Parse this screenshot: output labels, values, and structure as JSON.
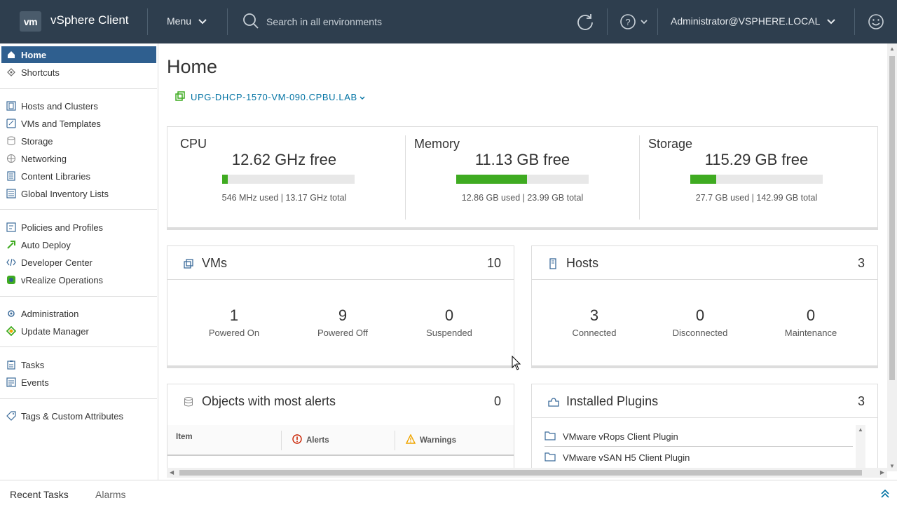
{
  "header": {
    "logo": "vm",
    "app_title": "vSphere Client",
    "menu_label": "Menu",
    "search_placeholder": "Search in all environments",
    "user": "Administrator@VSPHERE.LOCAL",
    "colors": {
      "bg": "#2e3e4e",
      "accent": "#0072a3",
      "bar_fill": "#3fab21"
    }
  },
  "sidebar": {
    "items": [
      {
        "label": "Home",
        "icon": "home-icon"
      },
      {
        "label": "Shortcuts",
        "icon": "shortcuts-icon"
      },
      {
        "label": "Hosts and Clusters",
        "icon": "hosts-clusters-icon"
      },
      {
        "label": "VMs and Templates",
        "icon": "vms-templates-icon"
      },
      {
        "label": "Storage",
        "icon": "storage-icon"
      },
      {
        "label": "Networking",
        "icon": "networking-icon"
      },
      {
        "label": "Content Libraries",
        "icon": "content-libraries-icon"
      },
      {
        "label": "Global Inventory Lists",
        "icon": "inventory-lists-icon"
      },
      {
        "label": "Policies and Profiles",
        "icon": "policies-icon"
      },
      {
        "label": "Auto Deploy",
        "icon": "auto-deploy-icon"
      },
      {
        "label": "Developer Center",
        "icon": "developer-center-icon"
      },
      {
        "label": "vRealize Operations",
        "icon": "vrealize-icon"
      },
      {
        "label": "Administration",
        "icon": "administration-icon"
      },
      {
        "label": "Update Manager",
        "icon": "update-manager-icon"
      },
      {
        "label": "Tasks",
        "icon": "tasks-icon"
      },
      {
        "label": "Events",
        "icon": "events-icon"
      },
      {
        "label": "Tags & Custom Attributes",
        "icon": "tags-icon"
      }
    ]
  },
  "main": {
    "title": "Home",
    "environment": "UPG-DHCP-1570-VM-090.CPBU.LAB",
    "resources": {
      "cpu": {
        "title": "CPU",
        "free": "12.62 GHz free",
        "detail": "546 MHz used | 13.17 GHz total",
        "used_pct": 4.1
      },
      "memory": {
        "title": "Memory",
        "free": "11.13 GB free",
        "detail": "12.86 GB used | 23.99 GB total",
        "used_pct": 53.6
      },
      "storage": {
        "title": "Storage",
        "free": "115.29 GB free",
        "detail": "27.7 GB used | 142.99 GB total",
        "used_pct": 19.4
      }
    },
    "vms": {
      "title": "VMs",
      "count": "10",
      "stats": [
        {
          "value": "1",
          "label": "Powered On"
        },
        {
          "value": "9",
          "label": "Powered Off"
        },
        {
          "value": "0",
          "label": "Suspended"
        }
      ]
    },
    "hosts": {
      "title": "Hosts",
      "count": "3",
      "stats": [
        {
          "value": "3",
          "label": "Connected"
        },
        {
          "value": "0",
          "label": "Disconnected"
        },
        {
          "value": "0",
          "label": "Maintenance"
        }
      ]
    },
    "alerts": {
      "title": "Objects with most alerts",
      "count": "0",
      "columns": [
        "Item",
        "Alerts",
        "Warnings"
      ]
    },
    "plugins": {
      "title": "Installed Plugins",
      "count": "3",
      "items": [
        "VMware vRops Client Plugin",
        "VMware vSAN H5 Client Plugin"
      ]
    }
  },
  "bottom": {
    "tabs": [
      "Recent Tasks",
      "Alarms"
    ]
  }
}
